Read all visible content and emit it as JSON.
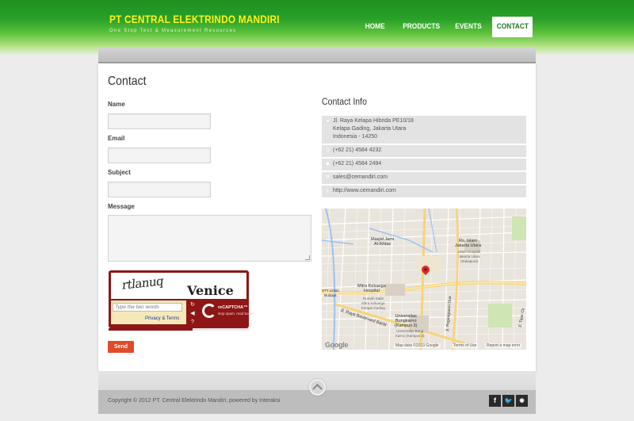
{
  "brand": {
    "title": "PT CENTRAL ELEKTRINDO MANDIRI",
    "tagline": "One Stop Test & Measurement Resources"
  },
  "nav": {
    "items": [
      {
        "label": "HOME"
      },
      {
        "label": "PRODUCTS"
      },
      {
        "label": "EVENTS"
      },
      {
        "label": "CONTACT",
        "active": true
      }
    ]
  },
  "page": {
    "title": "Contact"
  },
  "form": {
    "name_label": "Name",
    "email_label": "Email",
    "subject_label": "Subject",
    "message_label": "Message",
    "captcha": {
      "word1": "rtlanuq",
      "word2": "Venice",
      "placeholder": "Type the two words",
      "privacy": "Privacy & Terms",
      "logo": "reCAPTCHA™",
      "logo_sub": "stop spam. read books."
    },
    "send_label": "Send"
  },
  "contact_info": {
    "title": "Contact Info",
    "address_line1": "Jl. Raya Kelapa Hibrida PE10/18",
    "address_line2": "Kelapa Gading, Jakarta Utara",
    "address_line3": "Indonesia - 14250",
    "phone": "(+62 21) 4584 4232",
    "fax": "(+62 21) 4584 2494",
    "email": "sales@cemandiri.com",
    "website": "http://www.cemandiri.com"
  },
  "map": {
    "labels": {
      "masjid": "Masjid Jami\nAl-Ikhlas",
      "rs_islam": "Rs. Islam\nJakarta Utara",
      "rs_islam_en": "Islam Hospital\nJakarta Utara\n(Sukapura)",
      "mitra": "Mitra Keluarga\nHospital",
      "mitra_sub": "Rumah Sakit\nMitra Keluarga\nKelapa Gading",
      "stt": "STT Lintas\nBudaya",
      "ubk": "Universitas\nBungkarno\n(Kampus 3)",
      "ubk_sub": "Universitas Bung\nKarno (Kampus 3)",
      "boulevard": "Jl. Raya Boulevard Barat",
      "pegangsaan": "Jl. Pegangsaan Dua",
      "tipar": "Jl. Tipar Ck"
    },
    "google": "Google",
    "map_data": "Map data ©2013 Google",
    "terms": "Terms of Use",
    "report": "Report a map error"
  },
  "footer": {
    "copyright": "Copyright © 2012 PT. Central Elektrindo Mandiri, powered by Interaksi",
    "social": [
      "f",
      "t",
      "rss"
    ]
  }
}
